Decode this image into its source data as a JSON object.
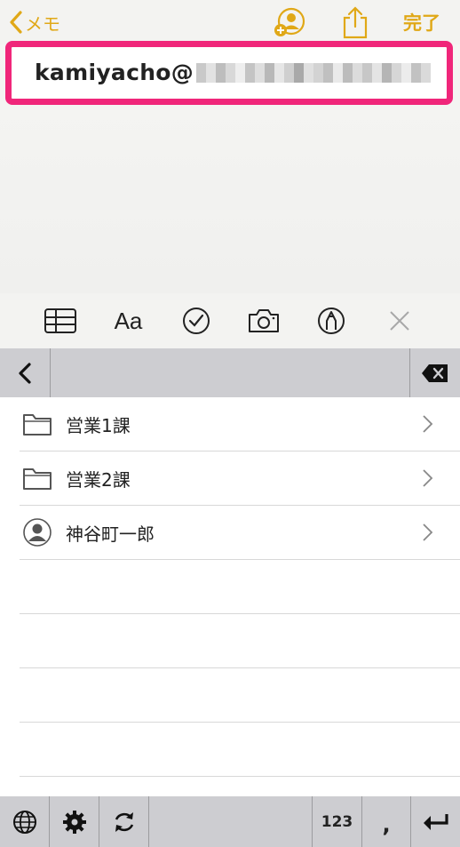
{
  "nav": {
    "back_label": "メモ",
    "done_label": "完了",
    "accent": "#e0a817",
    "icons": [
      "add-person-icon",
      "share-icon"
    ]
  },
  "note": {
    "text": "kamiyacho@",
    "highlight_color": "#f0267a"
  },
  "format_bar": {
    "text_style_label": "Aa",
    "icons": [
      "table-icon",
      "text-format-icon",
      "checklist-icon",
      "camera-icon",
      "markup-pen-icon",
      "close-icon"
    ]
  },
  "keyboard": {
    "numbers_label": "123",
    "comma_label": ",",
    "icons": [
      "back-arrow-icon",
      "delete-icon",
      "globe-icon",
      "settings-icon",
      "refresh-icon",
      "return-icon"
    ]
  },
  "list": {
    "items": [
      {
        "label": "営業1課",
        "icon": "folder-icon"
      },
      {
        "label": "営業2課",
        "icon": "folder-icon"
      },
      {
        "label": "神谷町一郎",
        "icon": "person-icon"
      }
    ]
  }
}
